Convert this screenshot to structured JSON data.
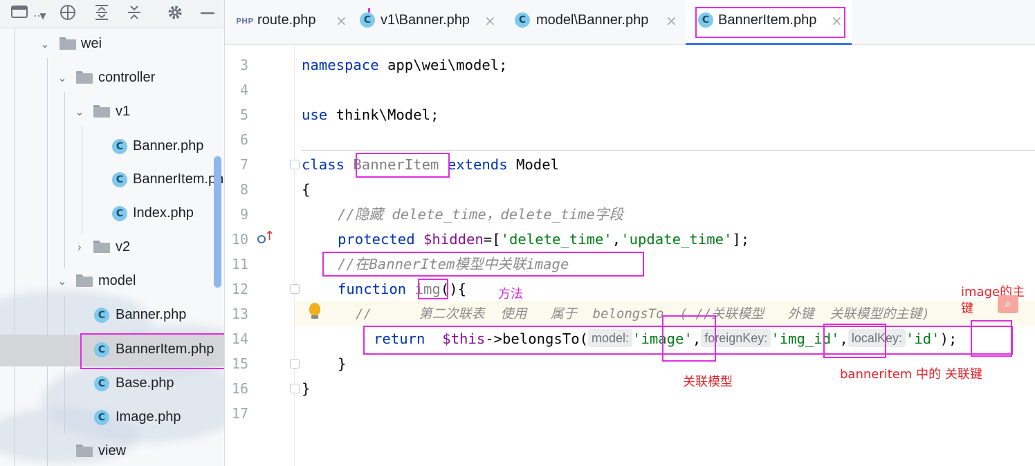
{
  "toolbar": {
    "project_label": "...",
    "icons": [
      "project-view-icon",
      "crosshair-icon",
      "expand-all-icon",
      "collapse-all-icon",
      "gear-icon",
      "minimize-icon"
    ]
  },
  "tree": [
    {
      "label": "wei",
      "type": "folder",
      "expanded": true
    },
    {
      "label": "controller",
      "type": "folder",
      "expanded": true
    },
    {
      "label": "v1",
      "type": "folder",
      "expanded": true
    },
    {
      "label": "Banner.php",
      "type": "class"
    },
    {
      "label": "BannerItem.ph",
      "type": "class"
    },
    {
      "label": "Index.php",
      "type": "class"
    },
    {
      "label": "v2",
      "type": "folder",
      "expanded": false
    },
    {
      "label": "model",
      "type": "folder",
      "expanded": true
    },
    {
      "label": "Banner.php",
      "type": "class"
    },
    {
      "label": "BannerItem.php",
      "type": "class",
      "selected": true
    },
    {
      "label": "Base.php",
      "type": "class"
    },
    {
      "label": "Image.php",
      "type": "class"
    },
    {
      "label": "view",
      "type": "folder",
      "expanded": false
    }
  ],
  "tabs": [
    {
      "label": "route.php",
      "icon": "php-file-icon",
      "icon_text": "PHP"
    },
    {
      "label": "v1\\Banner.php",
      "icon": "class-icon",
      "icon_text": "C"
    },
    {
      "label": "model\\Banner.php",
      "icon": "class-icon",
      "icon_text": "C"
    },
    {
      "label": "BannerItem.php",
      "icon": "class-icon",
      "icon_text": "C",
      "active": true
    }
  ],
  "tab_close_glyph": "×",
  "line_numbers": [
    "3",
    "4",
    "5",
    "6",
    "7",
    "8",
    "9",
    "10",
    "11",
    "12",
    "13",
    "14",
    "15",
    "16",
    "17"
  ],
  "code": {
    "l3": {
      "kw": "namespace",
      "rest": " app\\wei\\model;"
    },
    "l5": {
      "kw": "use",
      "rest": " think\\Model;"
    },
    "l7": {
      "kw": "class",
      "name": "BannerItem",
      "kw2": "extends",
      "rest": " Model"
    },
    "l8": "{",
    "l9": "//隐藏 delete_time，delete_time字段",
    "l10": {
      "kw": "protected",
      "var": "$hidden",
      "eq": "=[",
      "s1": "'delete_time'",
      "comma": ",",
      "s2": "'update_time'",
      "end": "];"
    },
    "l11": "//在BannerItem模型中关联image",
    "l12": {
      "kw": "function",
      "name": "img",
      "end": "(){"
    },
    "l13": "//      第二次联表  使用   属于  belongsTo  ( //关联模型   外键  关联模型的主键)",
    "l14": {
      "kw": "return",
      "var": "$this",
      "method": "->belongsTo(",
      "hint1": "model:",
      "s1": "'image'",
      "comma": ",",
      "hint2": "foreignKey:",
      "s2": "'img_id'",
      "hint3": "localKey:",
      "s3": "'id'",
      "end": ");"
    },
    "l15": "}",
    "l16": "}"
  },
  "annotations": {
    "method": "方法",
    "image_pk_line1": "image的主",
    "image_pk_line2": "键",
    "related_model": "关联模型",
    "banneritem_fk": "banneritem 中的 关联键"
  },
  "colors": {
    "highlight_box": "#e02de0",
    "annotation_red": "#e8232a",
    "annotation_magenta": "#d72be0",
    "accent": "#3574f0"
  }
}
